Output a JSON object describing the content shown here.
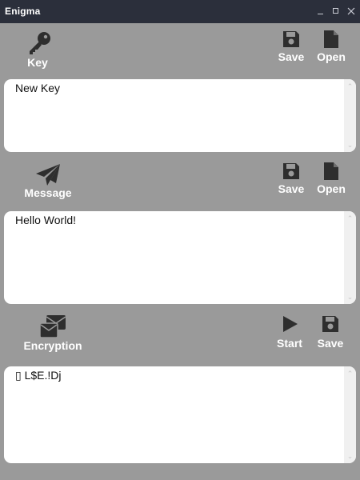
{
  "window": {
    "title": "Enigma",
    "controls": [
      "minimize",
      "maximize",
      "close"
    ]
  },
  "key_section": {
    "label": "Key",
    "icon": "key-icon",
    "save_label": "Save",
    "open_label": "Open",
    "text": "New Key"
  },
  "message_section": {
    "label": "Message",
    "icon": "paper-plane-icon",
    "save_label": "Save",
    "open_label": "Open",
    "text": "Hello World!"
  },
  "encryption_section": {
    "label": "Encryption",
    "icon": "envelopes-icon",
    "start_label": "Start",
    "save_label": "Save",
    "text": "▯ L$E.!Dj"
  },
  "colors": {
    "titlebar": "#2b2f3b",
    "background": "#9a9a9a",
    "icon": "#2e2e2e",
    "label": "#ffffff",
    "textbox": "#ffffff"
  }
}
